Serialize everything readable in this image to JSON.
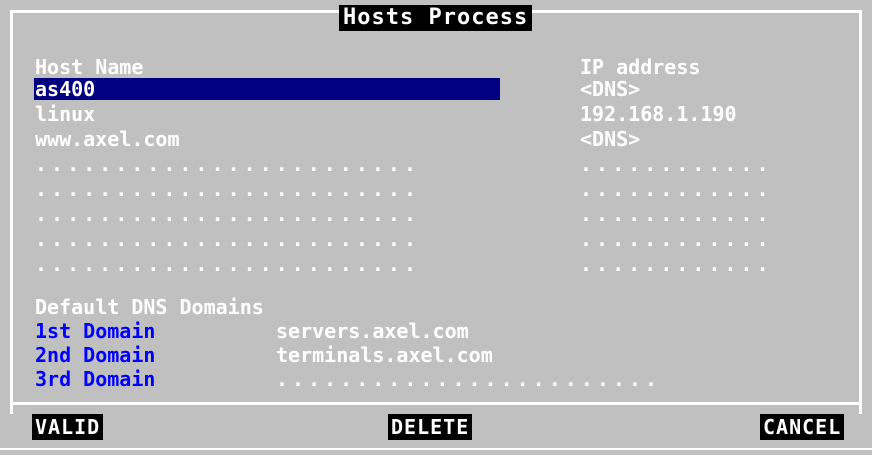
{
  "window": {
    "title": "Hosts Process"
  },
  "hosts": {
    "header_name": "Host Name",
    "header_ip": "IP address",
    "rows": [
      {
        "name": "as400",
        "ip": "<DNS>",
        "selected": true
      },
      {
        "name": "linux",
        "ip": "192.168.1.190"
      },
      {
        "name": "www.axel.com",
        "ip": "<DNS>"
      },
      {
        "name": "........................",
        "ip": "............"
      },
      {
        "name": "........................",
        "ip": "............"
      },
      {
        "name": "........................",
        "ip": "............"
      },
      {
        "name": "........................",
        "ip": "............"
      },
      {
        "name": "........................",
        "ip": "............"
      }
    ]
  },
  "dns": {
    "header": "Default DNS Domains",
    "domains": [
      {
        "label": "1st Domain",
        "value": "servers.axel.com"
      },
      {
        "label": "2nd Domain",
        "value": "terminals.axel.com"
      },
      {
        "label": "3rd Domain",
        "value": "........................"
      }
    ]
  },
  "buttons": {
    "valid": "VALID",
    "delete": "DELETE",
    "cancel": "CANCEL"
  },
  "colors": {
    "background": "#c0c0c0",
    "selection": "#000080",
    "label_blue": "#0000ff",
    "text": "#ffffff"
  }
}
